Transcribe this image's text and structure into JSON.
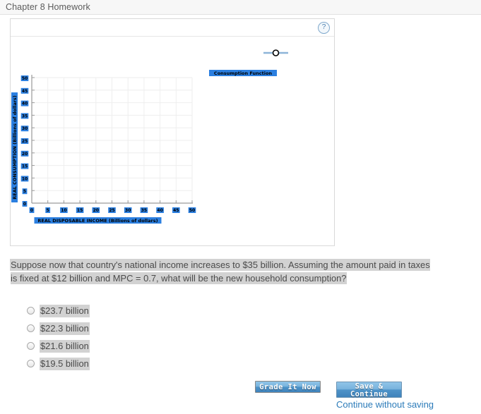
{
  "header": {
    "title": "Chapter 8 Homework"
  },
  "chart_panel": {
    "help_icon_label": "?"
  },
  "chart_data": {
    "type": "line",
    "title": "",
    "xlabel": "REAL DISPOSABLE INCOME (Billions of dollars)",
    "ylabel": "REAL CONSUMPTION (Billions of dollars)",
    "xlim": [
      0,
      50
    ],
    "ylim": [
      0,
      50
    ],
    "xticks": [
      0,
      5,
      10,
      15,
      20,
      25,
      30,
      35,
      40,
      45,
      50
    ],
    "yticks": [
      0,
      5,
      10,
      15,
      20,
      25,
      30,
      35,
      40,
      45,
      50
    ],
    "xtick_labels": [
      "0",
      "5",
      "10",
      "15",
      "20",
      "25",
      "30",
      "35",
      "40",
      "45",
      "50"
    ],
    "ytick_labels": [
      "0",
      "5",
      "10",
      "15",
      "20",
      "25",
      "30",
      "35",
      "40",
      "45",
      "50"
    ],
    "grid": true,
    "legend_position": "upper-right-outside",
    "series": [
      {
        "name": "Consumption Function",
        "x": [],
        "y": [],
        "color": "#8db4d8",
        "marker": "open-circle"
      }
    ],
    "highlight_color": "#2b7fe0"
  },
  "question": {
    "text": "Suppose now that country's national income increases to $35 billion. Assuming the amount paid in taxes is fixed at $12 billion and MPC = 0.7, what will be the new household consumption?"
  },
  "options": [
    {
      "label": "$23.7 billion",
      "selected": false
    },
    {
      "label": "$22.3 billion",
      "selected": false
    },
    {
      "label": "$21.6 billion",
      "selected": false
    },
    {
      "label": "$19.5 billion",
      "selected": false
    }
  ],
  "footer": {
    "grade_label": "Grade It Now",
    "save_line1": "Save &",
    "save_line2": "Continue",
    "continue_without_saving": "Continue without saving"
  },
  "colors": {
    "accent_blue": "#2b7bb9",
    "highlight_bg": "#d2d2d2",
    "legend_highlight": "#2b7fe0",
    "button_blue": "#4e93c8"
  }
}
